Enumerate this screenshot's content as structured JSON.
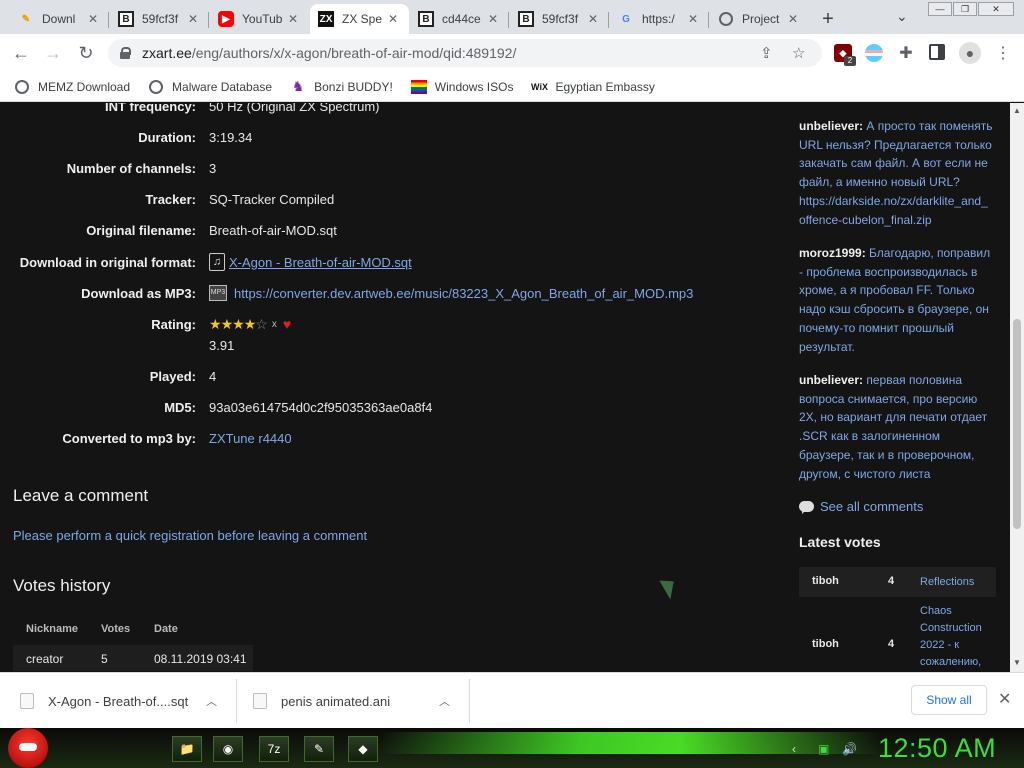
{
  "tabs": [
    {
      "title": "Downl",
      "icon": "download-icon"
    },
    {
      "title": "59fcf3f",
      "icon": "b-favicon-icon"
    },
    {
      "title": "YouTub",
      "icon": "youtube-icon"
    },
    {
      "title": "ZX Spe",
      "icon": "zx-favicon-icon",
      "active": true
    },
    {
      "title": "cd44ce",
      "icon": "b-favicon-icon"
    },
    {
      "title": "59fcf3f",
      "icon": "b-favicon-icon"
    },
    {
      "title": "https:/",
      "icon": "google-icon"
    },
    {
      "title": "Project",
      "icon": "globe-icon"
    }
  ],
  "address": {
    "host": "zxart.ee",
    "path": "/eng/authors/x/x-agon/breath-of-air-mod/qid:489192/"
  },
  "ublock_count": "2",
  "bookmarks": [
    {
      "label": "MEMZ Download",
      "icon": "globe-icon"
    },
    {
      "label": "Malware Database",
      "icon": "globe-icon"
    },
    {
      "label": "Bonzi BUDDY!",
      "icon": "bonzi-icon"
    },
    {
      "label": "Windows ISOs",
      "icon": "rainbow-flag-icon"
    },
    {
      "label": "Egyptian Embassy",
      "icon": "wix-icon"
    }
  ],
  "info": {
    "int_frequency_label": "INT frequency:",
    "int_frequency": "50 Hz (Original ZX Spectrum)",
    "duration_label": "Duration:",
    "duration": "3:19.34",
    "channels_label": "Number of channels:",
    "channels": "3",
    "tracker_label": "Tracker:",
    "tracker": "SQ-Tracker Compiled",
    "filename_label": "Original filename:",
    "filename": "Breath-of-air-MOD.sqt",
    "download_label": "Download in original format:",
    "download_link": "X-Agon - Breath-of-air-MOD.sqt",
    "mp3_label": "Download as MP3:",
    "mp3_link": "https://converter.dev.artweb.ee/music/83223_X_Agon_Breath_of_air_MOD.mp3",
    "rating_label": "Rating:",
    "rating_stars": 4,
    "rating_x": "x",
    "rating": "3.91",
    "played_label": "Played:",
    "played": "4",
    "md5_label": "MD5:",
    "md5": "93a03e614754d0c2f95035363ae0a8f4",
    "converted_label": "Converted to mp3 by:",
    "converted": "ZXTune r4440"
  },
  "comment_section": {
    "title": "Leave a comment",
    "register_link": "Please perform a quick registration before leaving a comment"
  },
  "votes_history": {
    "title": "Votes history",
    "columns": [
      "Nickname",
      "Votes",
      "Date"
    ],
    "rows": [
      {
        "nickname": "creator",
        "votes": "5",
        "date": "08.11.2019 03:41"
      }
    ]
  },
  "comments": [
    {
      "author": "unbeliever:",
      "lines": [
        "А просто так поменять",
        "URL нельзя? Предлагается только",
        "закачать сам файл. А вот если не",
        "файл, а именно новый URL?",
        "https://darkside.no/zx/darklite_and_",
        "offence-cubelon_final.zip"
      ]
    },
    {
      "author": "moroz1999:",
      "lines": [
        "Благодарю, поправил",
        "- проблема воспроизводилась в",
        "хроме, а я пробовал FF. Только",
        "надо кэш сбросить в браузере, он",
        "почему-то помнит прошлый",
        "результат."
      ]
    },
    {
      "author": "unbeliever:",
      "lines": [
        "первая половина",
        "вопроса снимается, про версию",
        "2X, но вариант для печати отдает",
        ".SCR как в залогиненном",
        "браузере, так и в проверочном,",
        "другом, с чистого листа"
      ]
    }
  ],
  "see_all_comments": "See all comments",
  "latest_votes": {
    "title": "Latest votes",
    "rows": [
      {
        "user": "tiboh",
        "vote": "4",
        "title_lines": [
          "Reflections"
        ]
      },
      {
        "user": "tiboh",
        "vote": "4",
        "title_lines": [
          "Chaos",
          "Construction",
          "2022 - к",
          "сожалению,"
        ]
      }
    ]
  },
  "downloads": [
    {
      "name": "X-Agon - Breath-of....sqt"
    },
    {
      "name": "penis animated.ani"
    }
  ],
  "show_all": "Show all",
  "taskbar": {
    "apps": [
      "folder-icon",
      "chrome-icon",
      "7zip-icon",
      "paint-icon",
      "pinball-icon"
    ],
    "app_labels": [
      "",
      "",
      "7z",
      "",
      ""
    ],
    "clock": "12:50 AM"
  },
  "colors": {
    "link": "#7fa7e6",
    "page_bg": "#141414",
    "clock": "#3fdc3f"
  }
}
